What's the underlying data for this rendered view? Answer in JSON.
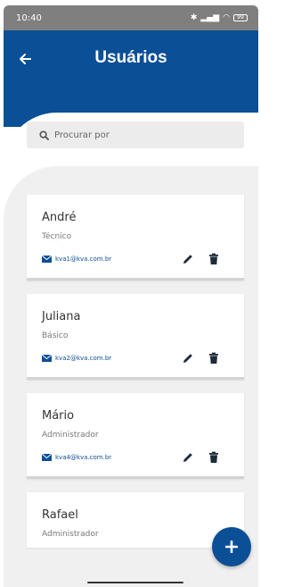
{
  "status_bar": {
    "time": "10:40",
    "battery": "99"
  },
  "header": {
    "title": "Usuários",
    "back_icon": "arrow-left-icon"
  },
  "search": {
    "placeholder": "Procurar por",
    "icon": "search-icon"
  },
  "users": [
    {
      "name": "André",
      "role": "Técnico",
      "email": "kva1@kva.com.br"
    },
    {
      "name": "Juliana",
      "role": "Básico",
      "email": "kva2@kva.com.br"
    },
    {
      "name": "Mário",
      "role": "Administrador",
      "email": "kva4@kva.com.br"
    },
    {
      "name": "Rafael",
      "role": "Administrador",
      "email": ""
    }
  ],
  "fab": {
    "label": "+"
  },
  "colors": {
    "primary": "#0b4f97",
    "list_background": "#f0f0f0",
    "card_background": "#ffffff"
  }
}
